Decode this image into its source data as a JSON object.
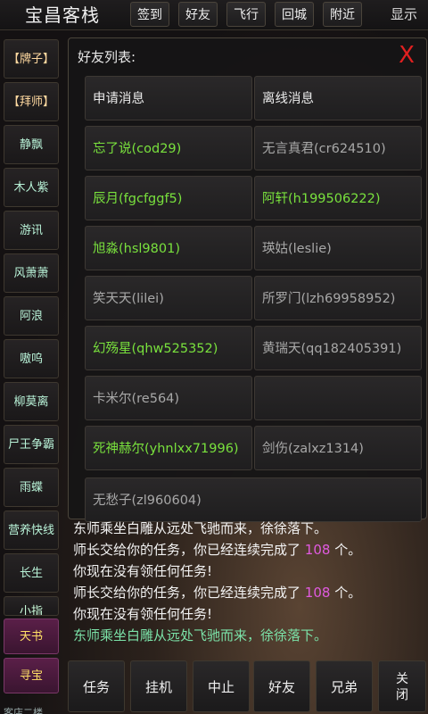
{
  "topbar": {
    "app_title": "宝昌客栈",
    "buttons": [
      "签到",
      "好友",
      "飞行",
      "回城",
      "附近"
    ],
    "show_label": "显示"
  },
  "sidebar": {
    "items": [
      "【牌子】",
      "【拜师】",
      "静飘",
      "木人紫",
      "游讯",
      "风萧萧",
      "阿浪",
      "嗷呜",
      "柳莫离",
      "尸王争霸",
      "雨蝶",
      "营养快线",
      "长生",
      "小指",
      "天书",
      "寻宝",
      "客店二楼"
    ]
  },
  "dialog": {
    "title": "好友列表:",
    "close_symbol": "X",
    "headers": [
      "申请消息",
      "离线消息"
    ],
    "rows": [
      [
        {
          "text": "忘了说(cod29)",
          "status": "online"
        },
        {
          "text": "无言真君(cr624510)",
          "status": "offline"
        }
      ],
      [
        {
          "text": "辰月(fgcfggf5)",
          "status": "online"
        },
        {
          "text": "阿轩(h199506222)",
          "status": "online"
        }
      ],
      [
        {
          "text": "旭淼(hsl9801)",
          "status": "online"
        },
        {
          "text": "瑛姑(leslie)",
          "status": "offline"
        }
      ],
      [
        {
          "text": "笑天天(lilei)",
          "status": "offline"
        },
        {
          "text": "所罗门(lzh69958952)",
          "status": "offline"
        }
      ],
      [
        {
          "text": "幻殇星(qhw525352)",
          "status": "online"
        },
        {
          "text": "黄瑞天(qq182405391)",
          "status": "offline"
        }
      ],
      [
        {
          "text": "卡米尔(re564)",
          "status": "offline"
        },
        {
          "text": "",
          "status": "offline"
        }
      ],
      [
        {
          "text": "死神赫尔(yhnlxx71996)",
          "status": "online"
        },
        {
          "text": "剑伤(zalxz1314)",
          "status": "offline"
        }
      ]
    ],
    "last_row": {
      "text": "无愁子(zl960604)",
      "status": "offline"
    }
  },
  "chat": {
    "lines": [
      {
        "before": "东师乘坐白雕从远处飞驰而来，徐徐落下。",
        "num": "",
        "after": "",
        "style": "white"
      },
      {
        "before": "师长交给你的任务，你已经连续完成了 ",
        "num": "108",
        "after": " 个。",
        "style": "white"
      },
      {
        "before": "你现在没有领任何任务!",
        "num": "",
        "after": "",
        "style": "white"
      },
      {
        "before": "师长交给你的任务，你已经连续完成了 ",
        "num": "108",
        "after": " 个。",
        "style": "white"
      },
      {
        "before": "你现在没有领任何任务!",
        "num": "",
        "after": "",
        "style": "white"
      },
      {
        "before": "东师乘坐白雕从远处飞驰而来，徐徐落下。",
        "num": "",
        "after": "",
        "style": "green"
      }
    ]
  },
  "bottombar": {
    "buttons": [
      "任务",
      "挂机",
      "中止",
      "好友",
      "兄弟"
    ],
    "close_label": [
      "关",
      "闭"
    ]
  },
  "colors": {
    "online": "#79e13d",
    "offline": "#a8a8a8",
    "close_x": "#e02020",
    "highlight_number": "#e05adf"
  }
}
